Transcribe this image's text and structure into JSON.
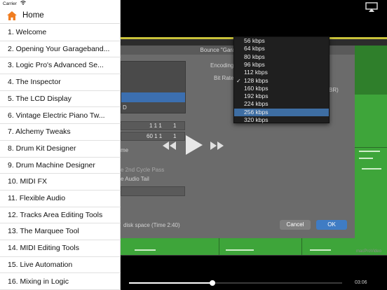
{
  "status_bar": {
    "carrier": "Carrier"
  },
  "sidebar": {
    "home_label": "Home",
    "items": [
      {
        "label": "1. Welcome"
      },
      {
        "label": "2. Opening Your Garageband..."
      },
      {
        "label": "3. Logic Pro's Advanced Se..."
      },
      {
        "label": "4. The Inspector"
      },
      {
        "label": "5. The LCD Display"
      },
      {
        "label": "6. Vintage Electric Piano Tw..."
      },
      {
        "label": "7. Alchemy Tweaks"
      },
      {
        "label": "8. Drum Kit Designer"
      },
      {
        "label": "9. Drum Machine Designer"
      },
      {
        "label": "10. MIDI FX"
      },
      {
        "label": "11. Flexible Audio"
      },
      {
        "label": "12. Tracks Area Editing Tools"
      },
      {
        "label": "13. The Marquee Tool"
      },
      {
        "label": "14. MIDI Editing Tools"
      },
      {
        "label": "15. Live Automation"
      },
      {
        "label": "16. Mixing in Logic"
      }
    ]
  },
  "video": {
    "dialog_title": "Bounce \"Garageband to Logic",
    "encoding_label": "Encoding",
    "bit_rate_label": "Bit Rate",
    "vbr_fragment": "BR)",
    "start_field": "1 1 1",
    "start_suffix": "1",
    "end_field": "60 1 1",
    "end_suffix": "1",
    "dest_fragment": "D",
    "option_fragment_1": "me",
    "option_fragment_2": "e 2nd Cycle Pass",
    "option_fragment_3": "e Audio Tail",
    "disk_space_text": "disk space (Time 2:40)",
    "cancel_label": "Cancel",
    "ok_label": "OK",
    "watermark": "macProVideo",
    "remaining_time": "03:06",
    "progress": 0.39,
    "bit_rate_options": [
      {
        "label": "56 kbps",
        "checked": false,
        "highlighted": false
      },
      {
        "label": "64 kbps",
        "checked": false,
        "highlighted": false
      },
      {
        "label": "80 kbps",
        "checked": false,
        "highlighted": false
      },
      {
        "label": "96 kbps",
        "checked": false,
        "highlighted": false
      },
      {
        "label": "112 kbps",
        "checked": false,
        "highlighted": false
      },
      {
        "label": "128 kbps",
        "checked": true,
        "highlighted": false
      },
      {
        "label": "160 kbps",
        "checked": false,
        "highlighted": false
      },
      {
        "label": "192 kbps",
        "checked": false,
        "highlighted": false
      },
      {
        "label": "224 kbps",
        "checked": false,
        "highlighted": false
      },
      {
        "label": "256 kbps",
        "checked": false,
        "highlighted": true
      },
      {
        "label": "320 kbps",
        "checked": false,
        "highlighted": false
      }
    ]
  },
  "colors": {
    "accent_orange": "#f07d21",
    "highlight_blue": "#3e6ea3",
    "track_green": "#3ea53a",
    "ok_blue": "#3f7cc4"
  },
  "icons": {
    "home": "home-icon",
    "wifi": "wifi-icon",
    "airplay": "airplay-icon",
    "rewind": "rewind-icon",
    "play": "play-icon",
    "fast_forward": "fast-forward-icon",
    "checkmark": "checkmark-icon"
  }
}
